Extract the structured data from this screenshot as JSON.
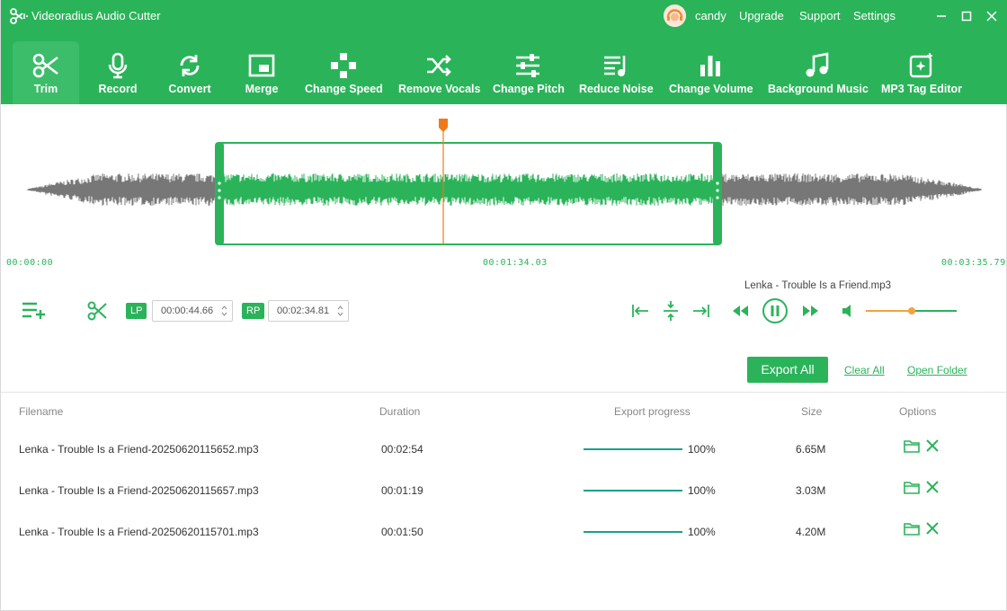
{
  "app": {
    "title": "Videoradius Audio Cutter"
  },
  "header": {
    "username": "candy",
    "menu": [
      "Upgrade",
      "Support",
      "Settings"
    ]
  },
  "toolbar": {
    "items": [
      {
        "label": "Trim",
        "icon": "scissors-icon",
        "active": true
      },
      {
        "label": "Record",
        "icon": "microphone-icon"
      },
      {
        "label": "Convert",
        "icon": "convert-icon"
      },
      {
        "label": "Merge",
        "icon": "merge-icon"
      },
      {
        "label": "Change Speed",
        "icon": "speed-icon"
      },
      {
        "label": "Remove Vocals",
        "icon": "shuffle-icon"
      },
      {
        "label": "Change Pitch",
        "icon": "sliders-icon"
      },
      {
        "label": "Reduce Noise",
        "icon": "noise-icon"
      },
      {
        "label": "Change Volume",
        "icon": "volume-bars-icon"
      },
      {
        "label": "Background Music",
        "icon": "music-note-icon"
      },
      {
        "label": "MP3 Tag Editor",
        "icon": "tag-editor-icon"
      }
    ]
  },
  "waveform": {
    "start_time": "00:00:00",
    "playhead_time": "00:01:34.03",
    "end_time": "00:03:35.79",
    "selection_start_fraction": 0.218,
    "selection_end_fraction": 0.72,
    "playhead_fraction": 0.438
  },
  "controls": {
    "lp_label": "LP",
    "lp_value": "00:00:44.66",
    "rp_label": "RP",
    "rp_value": "00:02:34.81",
    "song_name": "Lenka - Trouble Is a Friend.mp3",
    "volume_fraction": 0.5
  },
  "actions": {
    "export_all": "Export All",
    "clear_all": "Clear All",
    "open_folder": "Open Folder"
  },
  "table": {
    "headers": [
      "Filename",
      "Duration",
      "Export progress",
      "Size",
      "Options"
    ],
    "rows": [
      {
        "filename": "Lenka - Trouble Is a Friend-20250620115652.mp3",
        "duration": "00:02:54",
        "progress": "100%",
        "size": "6.65M"
      },
      {
        "filename": "Lenka - Trouble Is a Friend-20250620115657.mp3",
        "duration": "00:01:19",
        "progress": "100%",
        "size": "3.03M"
      },
      {
        "filename": "Lenka - Trouble Is a Friend-20250620115701.mp3",
        "duration": "00:01:50",
        "progress": "100%",
        "size": "4.20M"
      }
    ]
  },
  "colors": {
    "brand_green": "#2bb35a",
    "waveform_gray": "#777777",
    "playhead_orange": "#f07a1a",
    "progress_teal": "#1aa08c"
  }
}
